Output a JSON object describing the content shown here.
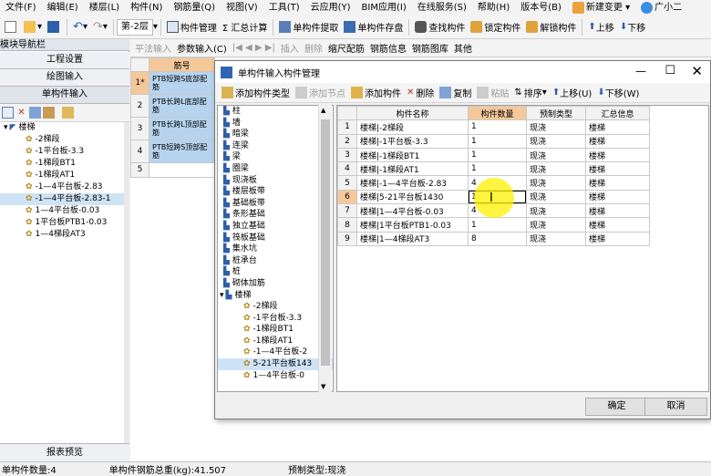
{
  "menu": [
    "文件(F)",
    "编辑(E)",
    "楼层(L)",
    "构件(N)",
    "钢筋量(Q)",
    "视图(V)",
    "工具(T)",
    "云应用(Y)",
    "BIM应用(I)",
    "在线服务(S)",
    "帮助(H)",
    "版本号(B)",
    "新建变更",
    "广小二"
  ],
  "toolbar": {
    "floor": "第-2层",
    "items": [
      "构件管理",
      "Σ 汇总计算",
      "单构件提取",
      "单构件存盘",
      "查找构件",
      "锁定构件",
      "解锁构件",
      "上移",
      "下移"
    ]
  },
  "left": {
    "title": "模块导航栏",
    "buttons": [
      "工程设置",
      "绘图输入",
      "单构件输入"
    ],
    "bottom": "报表预览",
    "tree": [
      {
        "label": "楼梯",
        "lvl": 0,
        "exp": "▾"
      },
      {
        "label": "-2梯段",
        "lvl": 1
      },
      {
        "label": "-1平台板-3.3",
        "lvl": 1
      },
      {
        "label": "-1梯段BT1",
        "lvl": 1
      },
      {
        "label": "-1梯段AT1",
        "lvl": 1
      },
      {
        "label": "-1—4平台板-2.83",
        "lvl": 1
      },
      {
        "label": "-1—4平台板-2.83-1",
        "lvl": 1,
        "sel": true
      },
      {
        "label": "1—4平台板-0.03",
        "lvl": 1
      },
      {
        "label": "1平台板PTB1-0.03",
        "lvl": 1
      },
      {
        "label": "1—4梯段AT3",
        "lvl": 1
      }
    ]
  },
  "maintb": [
    "平法输入",
    "参数输入(C)",
    "插入",
    "删除",
    "缩尺配筋",
    "钢筋信息",
    "钢筋图库",
    "其他"
  ],
  "maingrid": {
    "header": "筋号",
    "rows": [
      {
        "n": "1*",
        "t": "PTB短跨S底部配筋"
      },
      {
        "n": "2",
        "t": "PTB长跨L底部配筋"
      },
      {
        "n": "3",
        "t": "PTB长跨L顶部配筋"
      },
      {
        "n": "4",
        "t": "PTB短跨S顶部配筋"
      },
      {
        "n": "5",
        "t": ""
      }
    ]
  },
  "dialog": {
    "title": "单构件输入构件管理",
    "toolbar": [
      "添加构件类型",
      "添加节点",
      "添加构件",
      "删除",
      "复制",
      "粘贴",
      "排序",
      "上移(U)",
      "下移(W)"
    ],
    "tree": [
      {
        "label": "柱",
        "lvl": 0
      },
      {
        "label": "墙",
        "lvl": 0
      },
      {
        "label": "暗梁",
        "lvl": 0
      },
      {
        "label": "连梁",
        "lvl": 0
      },
      {
        "label": "梁",
        "lvl": 0
      },
      {
        "label": "圈梁",
        "lvl": 0
      },
      {
        "label": "现浇板",
        "lvl": 0
      },
      {
        "label": "楼层板带",
        "lvl": 0
      },
      {
        "label": "基础板带",
        "lvl": 0
      },
      {
        "label": "条形基础",
        "lvl": 0
      },
      {
        "label": "独立基础",
        "lvl": 0
      },
      {
        "label": "筏板基础",
        "lvl": 0
      },
      {
        "label": "集水坑",
        "lvl": 0
      },
      {
        "label": "桩承台",
        "lvl": 0
      },
      {
        "label": "桩",
        "lvl": 0
      },
      {
        "label": "砌体加筋",
        "lvl": 0
      },
      {
        "label": "楼梯",
        "lvl": 0,
        "exp": "▾"
      },
      {
        "label": "-2梯段",
        "lvl": 1
      },
      {
        "label": "-1平台板-3.3",
        "lvl": 1
      },
      {
        "label": "-1梯段BT1",
        "lvl": 1
      },
      {
        "label": "-1梯段AT1",
        "lvl": 1
      },
      {
        "label": "-1—4平台板-2",
        "lvl": 1
      },
      {
        "label": "5-21平台板143",
        "lvl": 1,
        "sel": true
      },
      {
        "label": "1—4平台板-0",
        "lvl": 1
      }
    ],
    "columns": [
      "",
      "构件名称",
      "构件数量",
      "预制类型",
      "汇总信息"
    ],
    "rows": [
      [
        "1",
        "楼梯|-2梯段",
        "1",
        "现浇",
        "楼梯"
      ],
      [
        "2",
        "楼梯|-1平台板-3.3",
        "1",
        "现浇",
        "楼梯"
      ],
      [
        "3",
        "楼梯|-1梯段BT1",
        "1",
        "现浇",
        "楼梯"
      ],
      [
        "4",
        "楼梯|-1梯段AT1",
        "1",
        "现浇",
        "楼梯"
      ],
      [
        "5",
        "楼梯|-1—4平台板-2.83",
        "4",
        "现浇",
        "楼梯"
      ],
      [
        "6",
        "楼梯|5-21平台板1430",
        "1",
        "现浇",
        "楼梯"
      ],
      [
        "7",
        "楼梯|1—4平台板-0.03",
        "4",
        "现浇",
        "楼梯"
      ],
      [
        "8",
        "楼梯|1平台板PTB1-0.03",
        "1",
        "现浇",
        "楼梯"
      ],
      [
        "9",
        "楼梯|1—4梯段AT3",
        "8",
        "现浇",
        "楼梯"
      ]
    ],
    "ok": "确定",
    "cancel": "取消"
  },
  "status": [
    "单构件数量:4",
    "单构件钢筋总重(kg):41.507",
    "预制类型:现浇"
  ]
}
